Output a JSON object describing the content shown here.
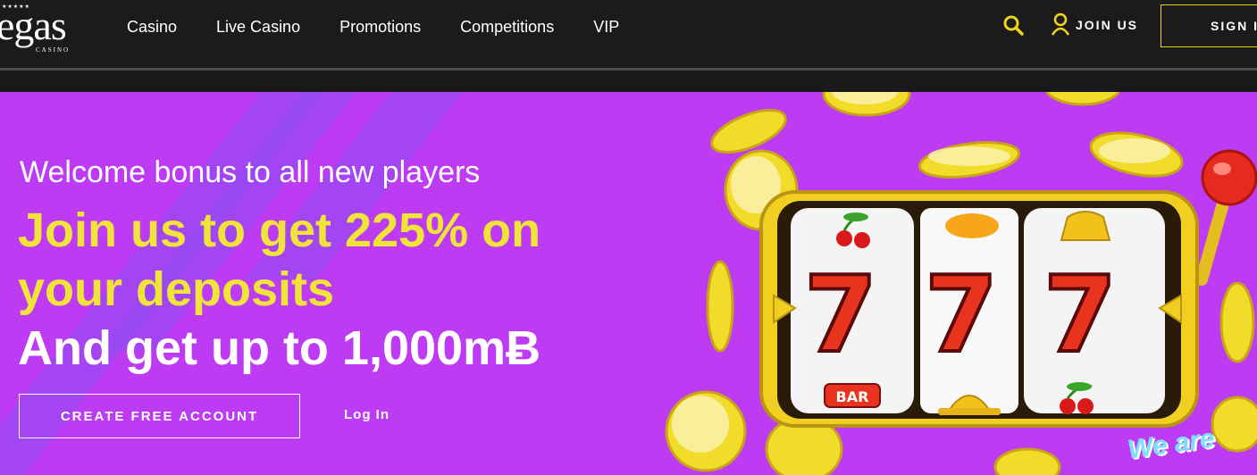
{
  "header": {
    "logo_text": "egas",
    "logo_sub": "CASINO",
    "nav": [
      "Casino",
      "Live Casino",
      "Promotions",
      "Competitions",
      "VIP"
    ],
    "join_label": "JOIN US",
    "signin_label": "SIGN I"
  },
  "hero": {
    "welcome": "Welcome bonus to all new players",
    "headline": "Join us to get 225% on your deposits",
    "subheadline": "And get up to 1,000mɃ",
    "cta_label": "CREATE FREE ACCOUNT",
    "login_label": "Log In",
    "slot_symbols": [
      "cherry-icon",
      "orange-icon",
      "bell-icon",
      "seven-icon",
      "seven-icon",
      "seven-icon",
      "bar-icon",
      "bell-icon",
      "cherry-icon"
    ],
    "bar_label": "BAR",
    "badge_text": "We are"
  },
  "colors": {
    "background": "#bd3cf3",
    "accent_yellow": "#f0e43a",
    "header": "#1b1b1b"
  }
}
